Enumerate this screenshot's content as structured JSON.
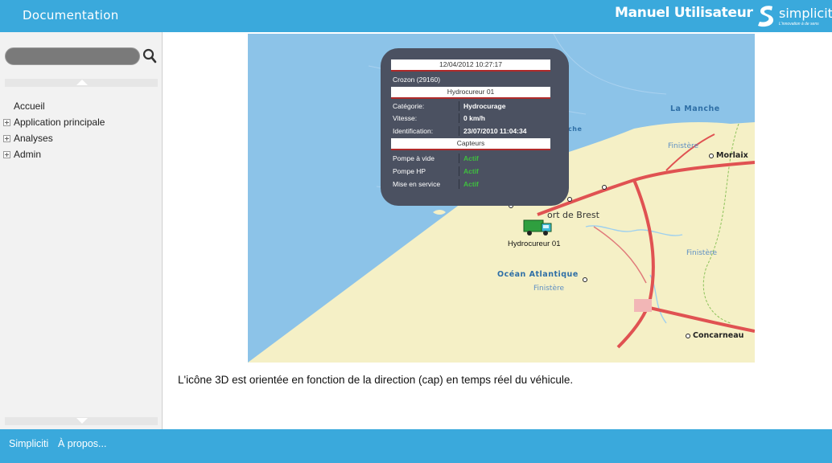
{
  "header": {
    "title": "Documentation",
    "manual": "Manuel Utilisateur",
    "logo_name": "simpliciti",
    "logo_tagline": "L'innovation à de sens"
  },
  "sidebar": {
    "search": {
      "value": "",
      "placeholder": ""
    },
    "items": [
      {
        "label": "Accueil",
        "expandable": false
      },
      {
        "label": "Application principale",
        "expandable": true
      },
      {
        "label": "Analyses",
        "expandable": true
      },
      {
        "label": "Admin",
        "expandable": true
      }
    ]
  },
  "map": {
    "labels": {
      "la_manche": "La Manche",
      "finistere_1": "Finistère",
      "finistere_2": "Finistère",
      "finistere_3": "Finistère",
      "ocean": "Océan Atlantique",
      "morlaix": "Morlaix",
      "concarneau": "Concarneau",
      "brest": "ort de Brest",
      "che": "che",
      "vehicle": "Hydrocureur 01"
    },
    "popup": {
      "datetime": "12/04/2012 10:27:17",
      "location": "Crozon (29160)",
      "vehicle_header": "Hydrocureur 01",
      "rows": [
        {
          "key": "Catégorie:",
          "value": "Hydrocurage"
        },
        {
          "key": "Vitesse:",
          "value": "0 km/h"
        },
        {
          "key": "Identification:",
          "value": "23/07/2010 11:04:34"
        }
      ],
      "sensors_header": "Capteurs",
      "sensors": [
        {
          "key": "Pompe à vide",
          "value": "Actif"
        },
        {
          "key": "Pompe HP",
          "value": "Actif"
        },
        {
          "key": "Mise en service",
          "value": "Actif"
        }
      ]
    }
  },
  "main": {
    "caption": "L'icône 3D est orientée en fonction de la direction (cap) en temps réel du véhicule."
  },
  "footer": {
    "link1": "Simpliciti",
    "link2": "À propos..."
  },
  "colors": {
    "brand": "#3aa9dc",
    "sea": "#8cc3e8",
    "land": "#f5f0c6",
    "road": "#e05252",
    "popup_bg": "#4b5161",
    "active": "#3fbf3f"
  }
}
